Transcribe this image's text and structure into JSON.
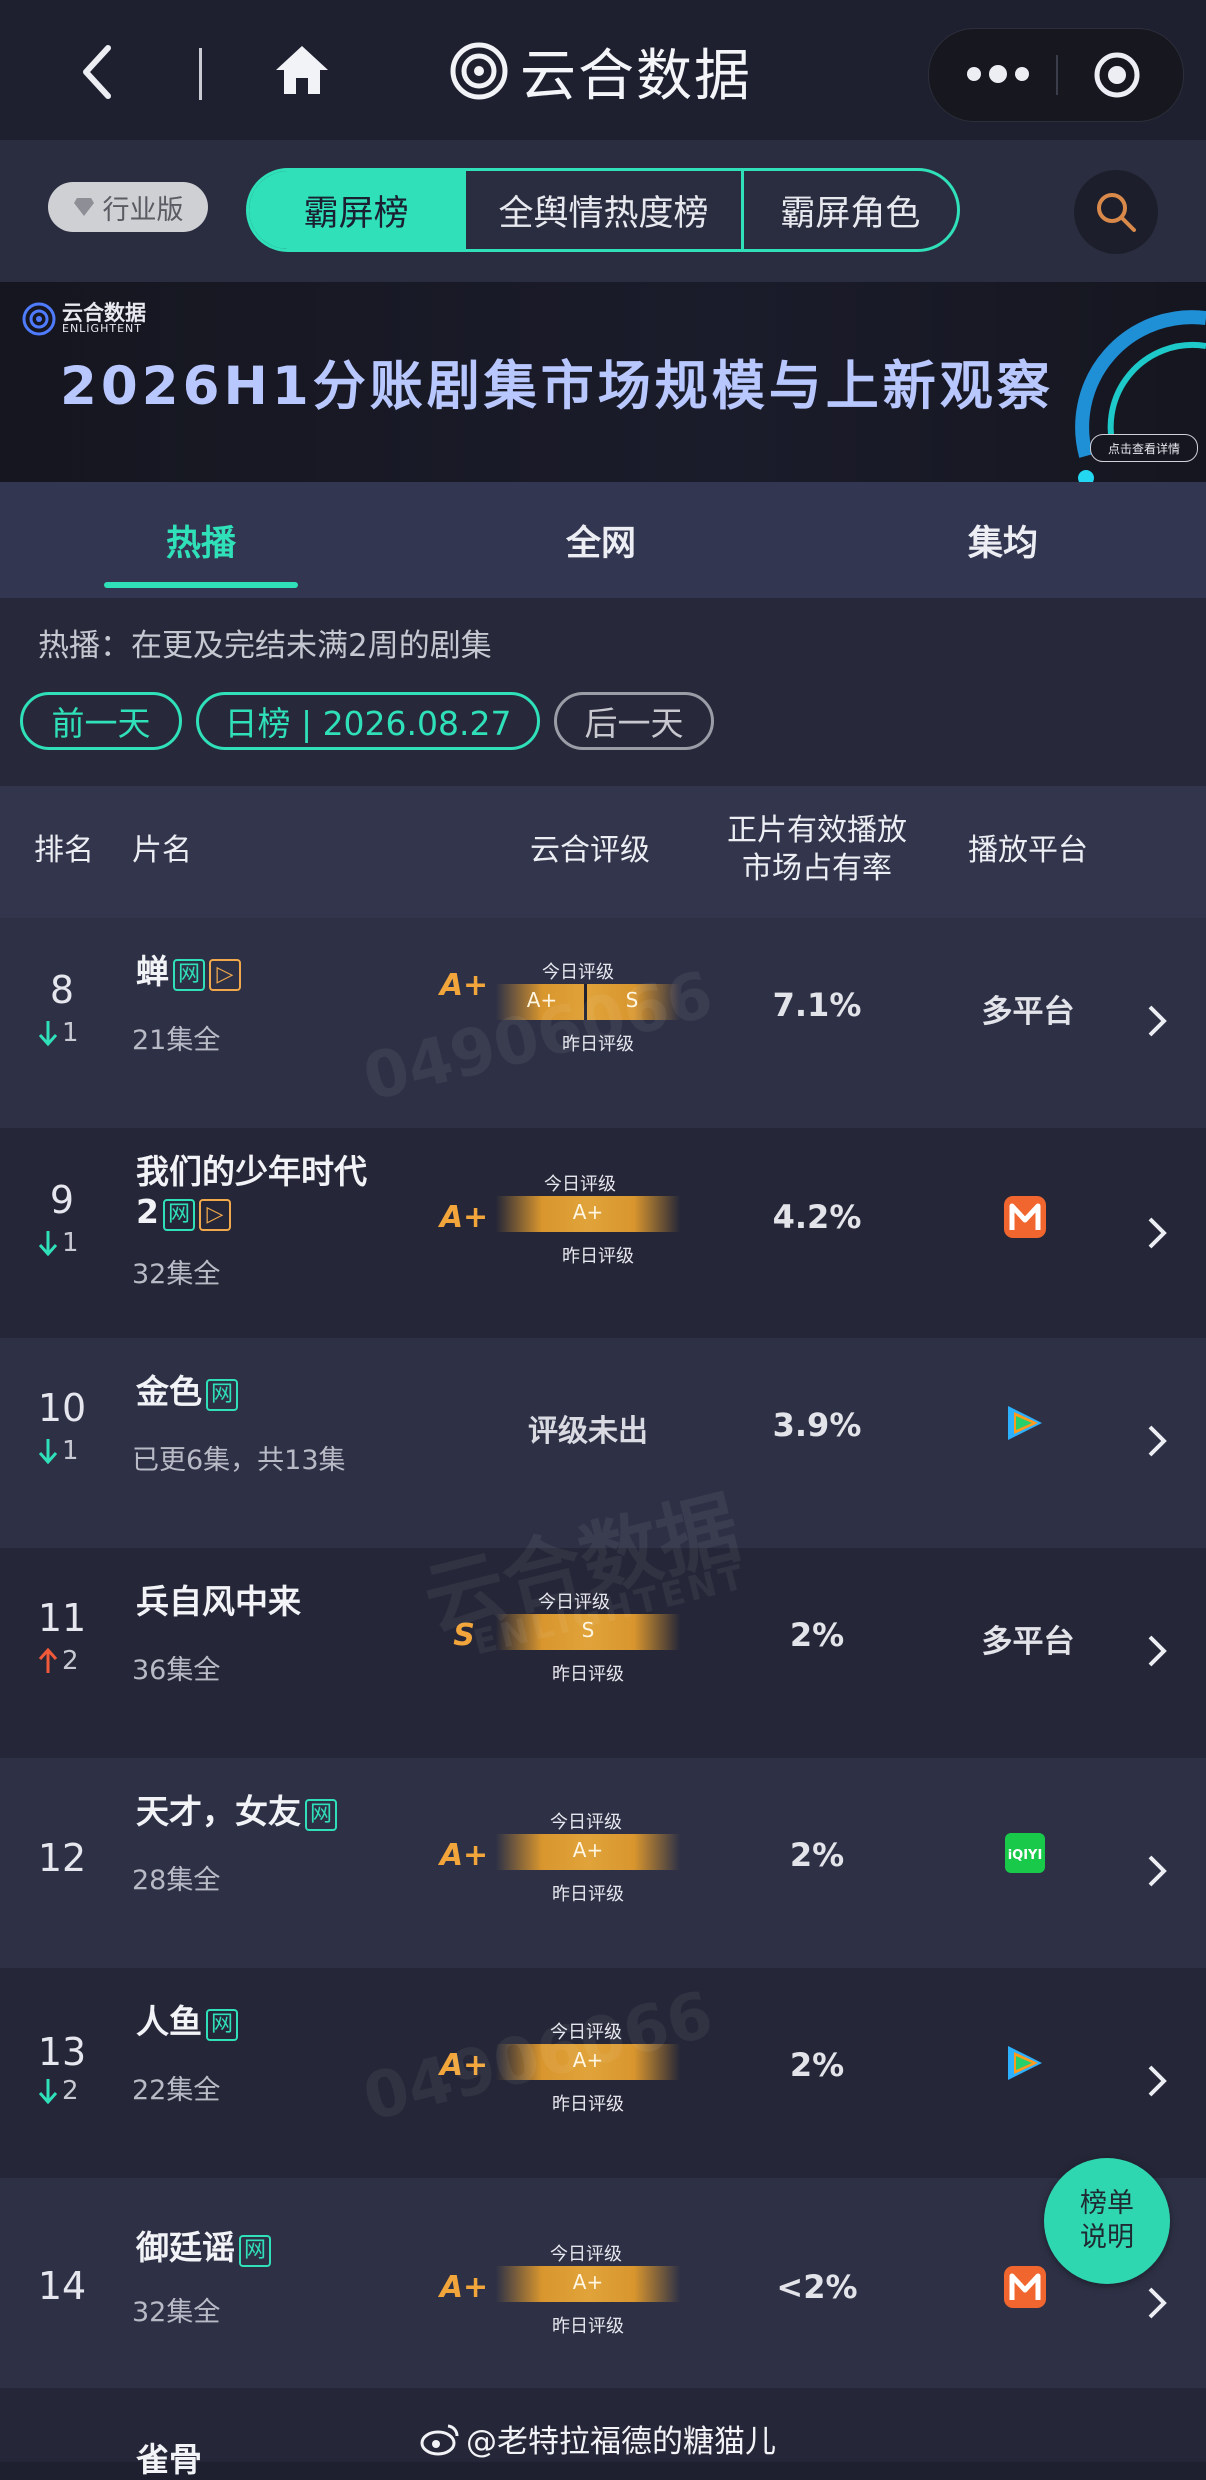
{
  "app": {
    "title": "云合数据"
  },
  "nav": {
    "edition": "行业版",
    "segments": [
      "霸屏榜",
      "全舆情热度榜",
      "霸屏角色"
    ]
  },
  "banner": {
    "brand_cn": "云合数据",
    "brand_en": "ENLIGHTENT",
    "headline": "2026H1分账剧集市场规模与上新观察",
    "detail_btn": "点击查看详情"
  },
  "tabs": [
    "热播",
    "全网",
    "集均"
  ],
  "info": {
    "desc": "热播：在更及完结未满2周的剧集",
    "prev_day": "前一天",
    "date_pill": "日榜 | 2026.08.27",
    "next_day": "后一天"
  },
  "table": {
    "headers": {
      "rank": "排名",
      "name": "片名",
      "grade": "云合评级",
      "share_line1": "正片有效播放",
      "share_line2": "市场占有率",
      "platform": "播放平台"
    },
    "grade_today_label": "今日评级",
    "grade_yesterday_label": "昨日评级",
    "rows": [
      {
        "rank": "8",
        "change": "1",
        "trend": "down",
        "name": "蝉",
        "name2": "",
        "tags": [
          "网",
          "▷"
        ],
        "sub": "21集全",
        "grade": "A+",
        "bar_today": "A+",
        "bar_yest": "S",
        "split": true,
        "share": "7.1%",
        "platform": "多平台",
        "platform_icon": ""
      },
      {
        "rank": "9",
        "change": "1",
        "trend": "down",
        "name": "我们的少年时代",
        "name2": "2",
        "tags": [
          "网",
          "▷"
        ],
        "sub": "32集全",
        "grade": "A+",
        "bar_today": "A+",
        "bar_yest": "",
        "split": false,
        "share": "4.2%",
        "platform": "",
        "platform_icon": "mango-tv-icon"
      },
      {
        "rank": "10",
        "change": "1",
        "trend": "down",
        "name": "金色",
        "name2": "",
        "tags": [
          "网"
        ],
        "sub": "已更6集，共13集",
        "grade": "",
        "no_grade": "评级未出",
        "share": "3.9%",
        "platform": "",
        "platform_icon": "tencent-video-icon"
      },
      {
        "rank": "11",
        "change": "2",
        "trend": "up",
        "name": "兵自风中来",
        "name2": "",
        "tags": [],
        "sub": "36集全",
        "grade": "S",
        "bar_today": "S",
        "bar_yest": "",
        "split": false,
        "share": "2%",
        "platform": "多平台",
        "platform_icon": ""
      },
      {
        "rank": "12",
        "change": "",
        "trend": "none",
        "name": "天才，女友",
        "name2": "",
        "tags": [
          "网"
        ],
        "sub": "28集全",
        "grade": "A+",
        "bar_today": "A+",
        "bar_yest": "",
        "split": false,
        "share": "2%",
        "platform": "",
        "platform_icon": "iqiyi-icon"
      },
      {
        "rank": "13",
        "change": "2",
        "trend": "down",
        "name": "人鱼",
        "name2": "",
        "tags": [
          "网"
        ],
        "sub": "22集全",
        "grade": "A+",
        "bar_today": "A+",
        "bar_yest": "",
        "split": false,
        "share": "2%",
        "platform": "",
        "platform_icon": "tencent-video-icon"
      },
      {
        "rank": "14",
        "change": "",
        "trend": "none",
        "name": "御廷谣",
        "name2": "",
        "tags": [
          "网"
        ],
        "sub": "32集全",
        "grade": "A+",
        "bar_today": "A+",
        "bar_yest": "",
        "split": false,
        "share": "<2%",
        "platform": "",
        "platform_icon": "mango-tv-icon"
      }
    ],
    "peek_row_name": "雀骨"
  },
  "float_btn": {
    "line1": "榜单",
    "line2": "说明"
  },
  "watermark": {
    "weibo_handle": "@老特拉福德的糖猫儿",
    "num": "04906066",
    "brand_cn": "云合数据",
    "brand_en": "ENLIGHTENT"
  },
  "colors": {
    "accent": "#2fe0b8",
    "grade": "#f2a53a",
    "down": "#2fe0b8",
    "up": "#f05a3a"
  }
}
